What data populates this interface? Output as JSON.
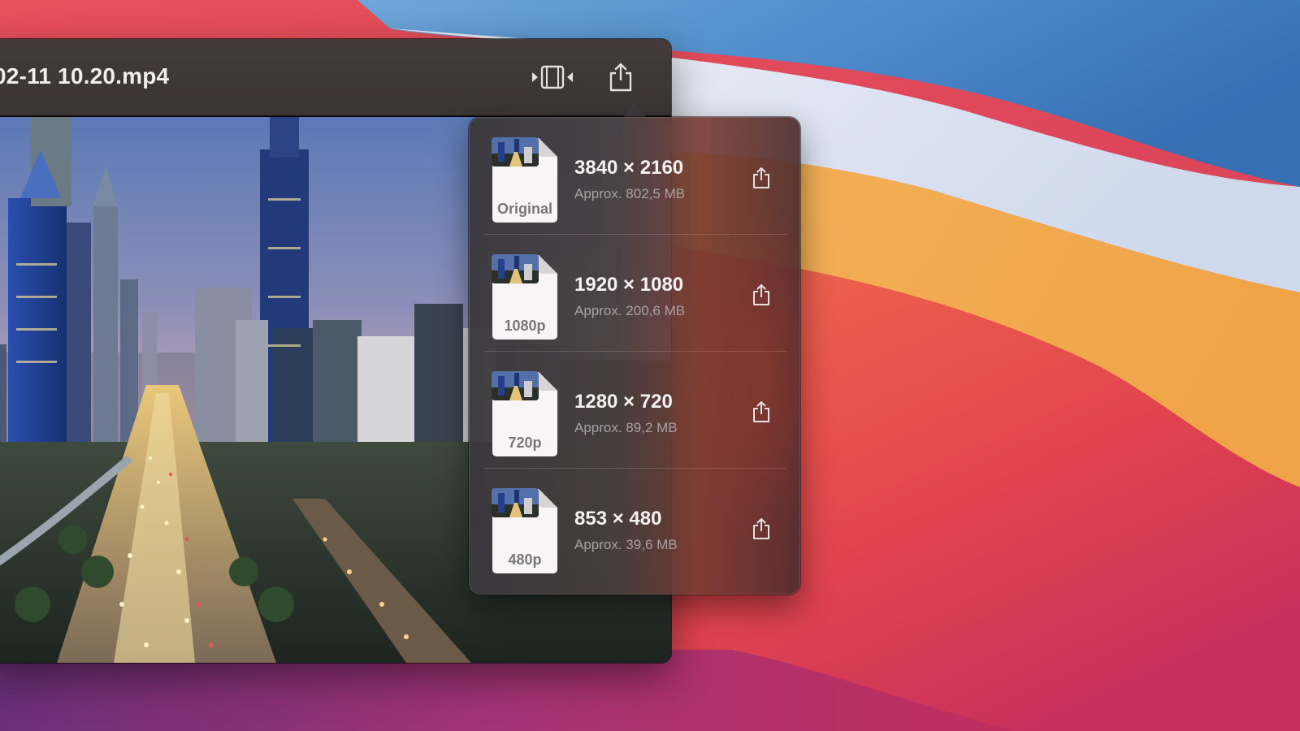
{
  "window": {
    "title": "02-11 10.20.mp4",
    "toolbar": {
      "trim_icon": "trim-icon",
      "share_icon": "share-icon"
    }
  },
  "share_menu": {
    "options": [
      {
        "label": "Original",
        "resolution": "3840 × 2160",
        "size": "Approx. 802,5 MB"
      },
      {
        "label": "1080p",
        "resolution": "1920 × 1080",
        "size": "Approx. 200,6 MB"
      },
      {
        "label": "720p",
        "resolution": "1280 × 720",
        "size": "Approx. 89,2 MB"
      },
      {
        "label": "480p",
        "resolution": "853 × 480",
        "size": "Approx. 39,6 MB"
      }
    ]
  },
  "colors": {
    "titlebar": "#3f3737",
    "popover": "#3e3b3f",
    "text_primary": "#f4f1f1",
    "text_secondary": "#a8a2a4"
  }
}
